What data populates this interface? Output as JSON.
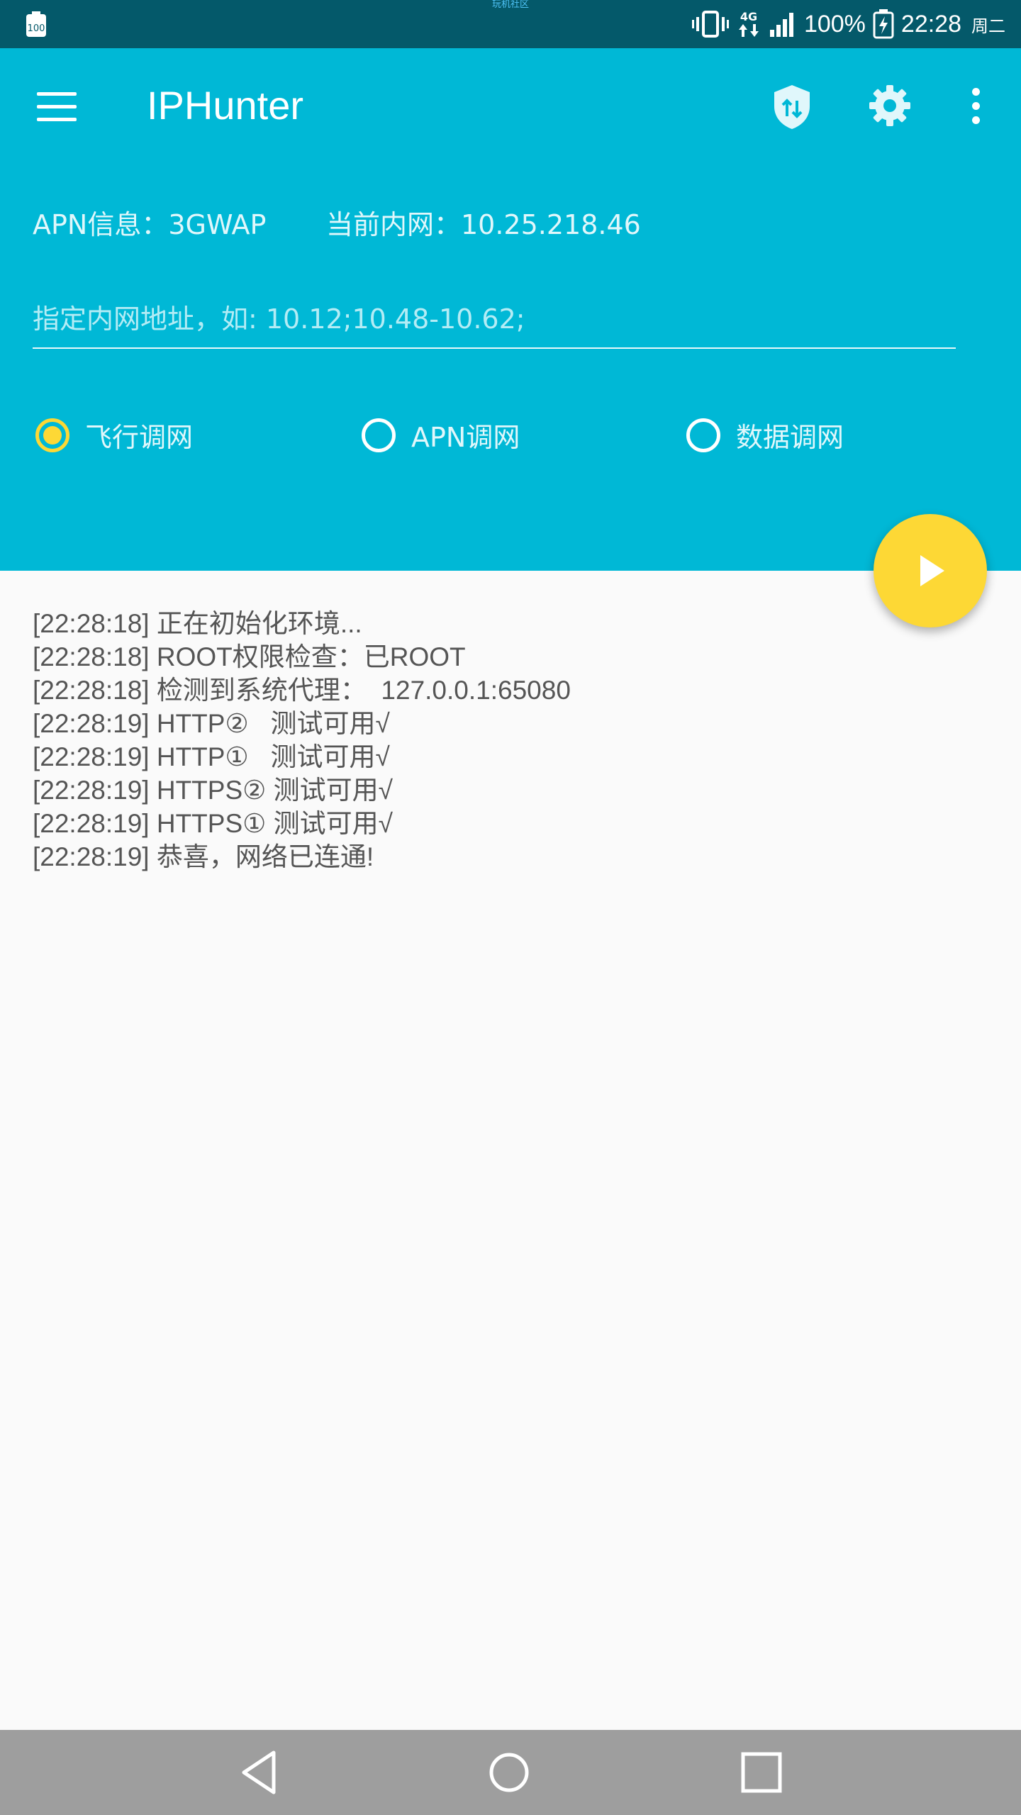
{
  "status_bar": {
    "battery_icon_label": "100",
    "carrier_text": "玩机社区",
    "network_label": "4G",
    "battery_percent": "100%",
    "time": "22:28",
    "weekday": "周二"
  },
  "app_bar": {
    "title": "IPHunter"
  },
  "header": {
    "apn_info": "APN信息：3GWAP",
    "current_ip": "当前内网：10.25.218.46",
    "address_input": {
      "value": "",
      "placeholder": "指定内网地址，如: 10.12;10.48-10.62;"
    },
    "modes": [
      {
        "label": "飞行调网",
        "checked": true
      },
      {
        "label": "APN调网",
        "checked": false
      },
      {
        "label": "数据调网",
        "checked": false
      }
    ]
  },
  "log": [
    "[22:28:18] 正在初始化环境...",
    "[22:28:18] ROOT权限检查：已ROOT",
    "[22:28:18] 检测到系统代理：  127.0.0.1:65080",
    "[22:28:19] HTTP②   测试可用√",
    "[22:28:19] HTTP①   测试可用√",
    "[22:28:19] HTTPS② 测试可用√",
    "[22:28:19] HTTPS① 测试可用√",
    "[22:28:19] 恭喜，网络已连通!"
  ],
  "colors": {
    "primary": "#00b8d6",
    "status_bar": "#04596a",
    "accent": "#fdd835",
    "nav_bar": "#9e9e9e"
  }
}
